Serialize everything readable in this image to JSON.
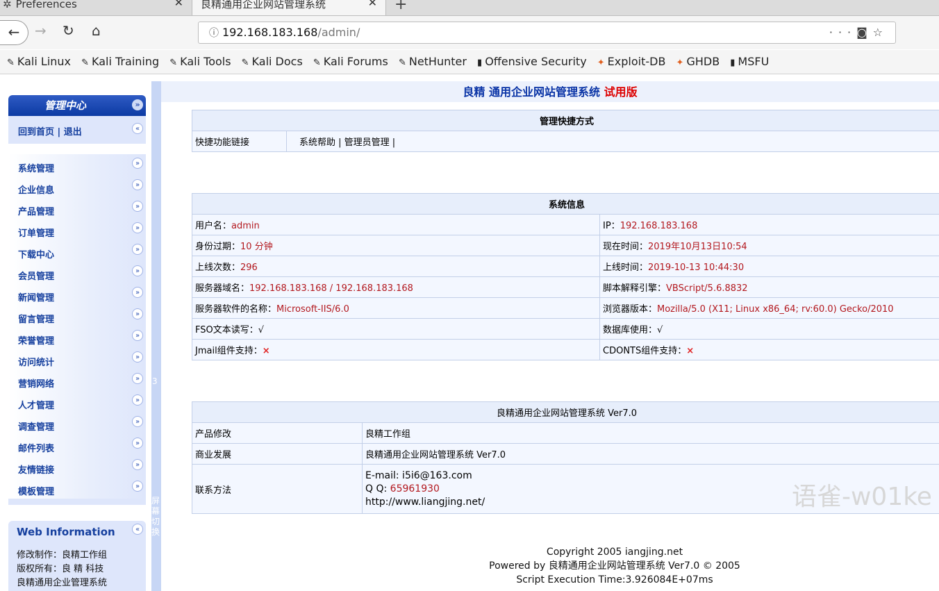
{
  "browser": {
    "tabs": [
      {
        "icon": "gear-icon",
        "label": "Preferences"
      },
      {
        "label": "良精通用企业网站管理系统"
      }
    ],
    "url_info_icon": "info-circle-icon",
    "url_host": "192.168.183.168",
    "url_path": "/admin/",
    "bookmarks": [
      "Kali Linux",
      "Kali Training",
      "Kali Tools",
      "Kali Docs",
      "Kali Forums",
      "NetHunter",
      "Offensive Security",
      "Exploit-DB",
      "GHDB",
      "MSFU"
    ]
  },
  "sidebar": {
    "panel_title": "管理中心",
    "home_link": "回到首页 | 退出",
    "menu": [
      "系统管理",
      "企业信息",
      "产品管理",
      "订单管理",
      "下载中心",
      "会员管理",
      "新闻管理",
      "留言管理",
      "荣誉管理",
      "访问统计",
      "营销网络",
      "人才管理",
      "调查管理",
      "邮件列表",
      "友情链接",
      "模板管理"
    ],
    "web_info_title": "Web Information",
    "web_info_lines": [
      "修改制作：良精工作组",
      "版权所有：良 精 科技",
      "良精通用企业管理系统"
    ]
  },
  "splitter": {
    "number": "3",
    "switch_text": [
      "屏",
      "幕",
      "切",
      "换"
    ]
  },
  "main": {
    "title_main": "良精 通用企业网站管理系统",
    "title_trial": "试用版",
    "shortcuts": {
      "header": "管理快捷方式",
      "label": "快捷功能链接",
      "links": "系统帮助 | 管理员管理 |"
    },
    "sysinfo": {
      "header": "系统信息",
      "rows": [
        {
          "l_label": "用户名：",
          "l_value": "admin",
          "r_label": "IP：",
          "r_value": "192.168.183.168"
        },
        {
          "l_label": "身份过期：",
          "l_value": "10 分钟",
          "r_label": "现在时间：",
          "r_value": "2019年10月13日10:54"
        },
        {
          "l_label": "上线次数：",
          "l_value": "296",
          "r_label": "上线时间：",
          "r_value": "2019-10-13 10:44:30"
        },
        {
          "l_label": "服务器域名：",
          "l_value": "192.168.183.168 / 192.168.183.168",
          "r_label": "脚本解释引擎：",
          "r_value": "VBScript/5.6.8832"
        },
        {
          "l_label": "服务器软件的名称：",
          "l_value": "Microsoft-IIS/6.0",
          "r_label": "浏览器版本：",
          "r_value": "Mozilla/5.0 (X11; Linux x86_64; rv:60.0) Gecko/2010"
        },
        {
          "l_label": "FSO文本读写：",
          "l_value": "√",
          "r_label": "数据库使用：",
          "r_value": "√"
        },
        {
          "l_label": "Jmail组件支持：",
          "l_value": "×",
          "r_label": "CDONTS组件支持：",
          "r_value": "×"
        }
      ]
    },
    "about": {
      "header": "良精通用企业网站管理系统 Ver7.0",
      "rows": [
        {
          "label": "产品修改",
          "value": "良精工作组"
        },
        {
          "label": "商业发展",
          "value": "良精通用企业网站管理系统 Ver7.0"
        }
      ],
      "contact_label": "联系方法",
      "contact_email": "E-mail: i5i6@163.com",
      "contact_qq_label": "Q Q: ",
      "contact_qq": "65961930",
      "contact_url": "http://www.liangjing.net/"
    },
    "copyright": [
      "Copyright 2005 iangjing.net",
      "Powered by 良精通用企业网站管理系统 Ver7.0 © 2005",
      "Script Execution Time:3.926084E+07ms"
    ]
  },
  "watermark": "语雀-w01ke"
}
